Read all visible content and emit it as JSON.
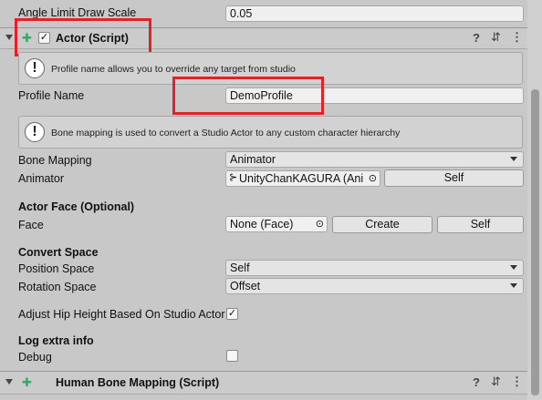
{
  "top_row": {
    "label": "Angle Limit Draw Scale",
    "value": "0.05"
  },
  "actor_header": {
    "title": "Actor (Script)",
    "enabled": true,
    "help_icon": "question-icon",
    "preset_icon": "sliders-icon",
    "menu_icon": "kebab-menu-icon"
  },
  "help1": {
    "text": "Profile name allows you to override any target from studio"
  },
  "profile": {
    "label": "Profile Name",
    "value": "DemoProfile"
  },
  "help2": {
    "text": "Bone mapping is used to convert a Studio Actor to any custom character hierarchy"
  },
  "bone_mapping": {
    "label": "Bone Mapping",
    "value": "Animator"
  },
  "animator": {
    "label": "Animator",
    "value": "UnityChanKAGURA (Ani",
    "self_button": "Self"
  },
  "actor_face": {
    "heading": "Actor Face (Optional)",
    "label": "Face",
    "value": "None (Face)",
    "create_button": "Create",
    "self_button": "Self"
  },
  "convert_space": {
    "heading": "Convert Space",
    "position_label": "Position Space",
    "position_value": "Self",
    "rotation_label": "Rotation Space",
    "rotation_value": "Offset"
  },
  "adjust_hip": {
    "label": "Adjust Hip Height Based On Studio Actor",
    "checked": true
  },
  "log": {
    "heading": "Log extra info",
    "debug_label": "Debug",
    "debug_checked": false
  },
  "human_bone_header": {
    "title": "Human Bone Mapping (Script)"
  },
  "colors": {
    "highlight": "#e5202a",
    "panel": "#c8c8c8"
  }
}
